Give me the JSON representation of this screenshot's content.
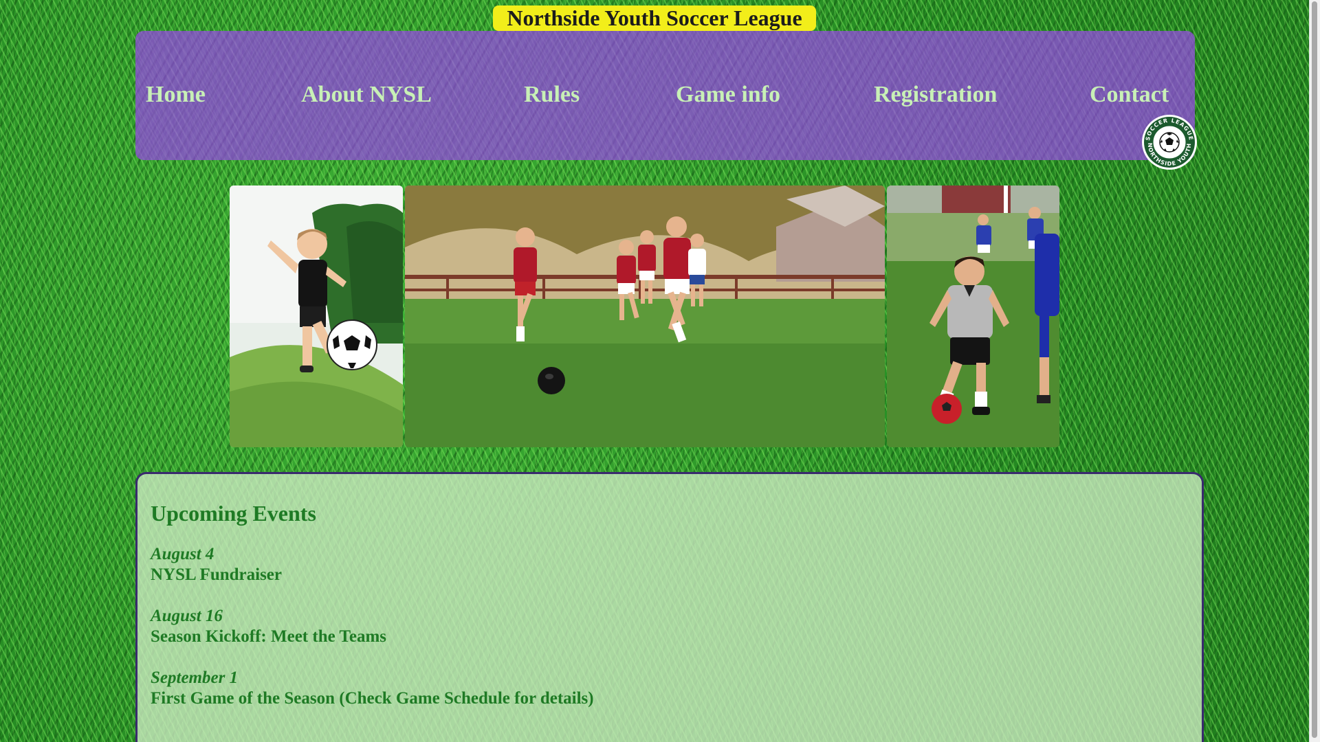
{
  "header": {
    "site_title": "Northside Youth Soccer League"
  },
  "nav": {
    "items": [
      {
        "label": "Home"
      },
      {
        "label": "About NYSL"
      },
      {
        "label": "Rules"
      },
      {
        "label": "Game info"
      },
      {
        "label": "Registration"
      },
      {
        "label": "Contact"
      }
    ],
    "logo_text_top": "SOCCER LEAGUE",
    "logo_text_bottom": "NORTHSIDE YOUTH"
  },
  "photos": [
    {
      "name": "boy-kicking-ball-photo"
    },
    {
      "name": "team-running-photo"
    },
    {
      "name": "boy-dribbling-photo"
    }
  ],
  "events": {
    "heading": "Upcoming Events",
    "items": [
      {
        "date": "August 4",
        "title": "NYSL Fundraiser"
      },
      {
        "date": "August 16",
        "title": "Season Kickoff: Meet the Teams"
      },
      {
        "date": "September 1",
        "title": "First Game of the Season (Check Game Schedule for details)"
      }
    ]
  },
  "colors": {
    "title_background": "#f2ee1a",
    "nav_background": "#8c50d2",
    "nav_text": "#c8f0b6",
    "events_text": "#1e7a24",
    "grass": "#2e9a2a"
  }
}
